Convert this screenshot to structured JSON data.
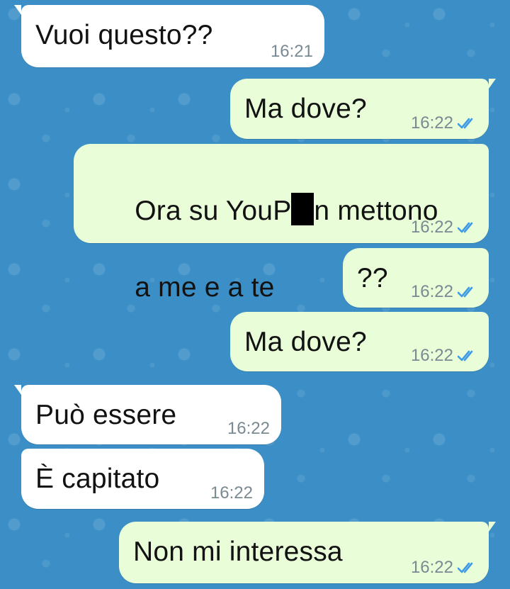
{
  "messages": [
    {
      "text": "Vuoi questo??",
      "time": "16:21",
      "direction": "incoming"
    },
    {
      "text": "Ma dove?",
      "time": "16:22",
      "direction": "outgoing",
      "status": "read"
    },
    {
      "text_prefix": "Ora su YouP",
      "text_suffix": "n mettono",
      "text_line2": "a me e a te",
      "time": "16:22",
      "direction": "outgoing",
      "status": "read"
    },
    {
      "text": "??",
      "time": "16:22",
      "direction": "outgoing",
      "status": "read"
    },
    {
      "text": "Ma dove?",
      "time": "16:22",
      "direction": "outgoing",
      "status": "read"
    },
    {
      "text": "Può essere",
      "time": "16:22",
      "direction": "incoming"
    },
    {
      "text": "È capitato",
      "time": "16:22",
      "direction": "incoming"
    },
    {
      "text": "Non mi interessa",
      "time": "16:22",
      "direction": "outgoing",
      "status": "read"
    }
  ],
  "colors": {
    "background": "#3b8fc6",
    "incoming_bubble": "#ffffff",
    "outgoing_bubble": "#e8fdd8",
    "read_ticks": "#3f9be6",
    "timestamp": "#7a8a93"
  },
  "icons": {
    "read_status": "double-check-icon"
  }
}
